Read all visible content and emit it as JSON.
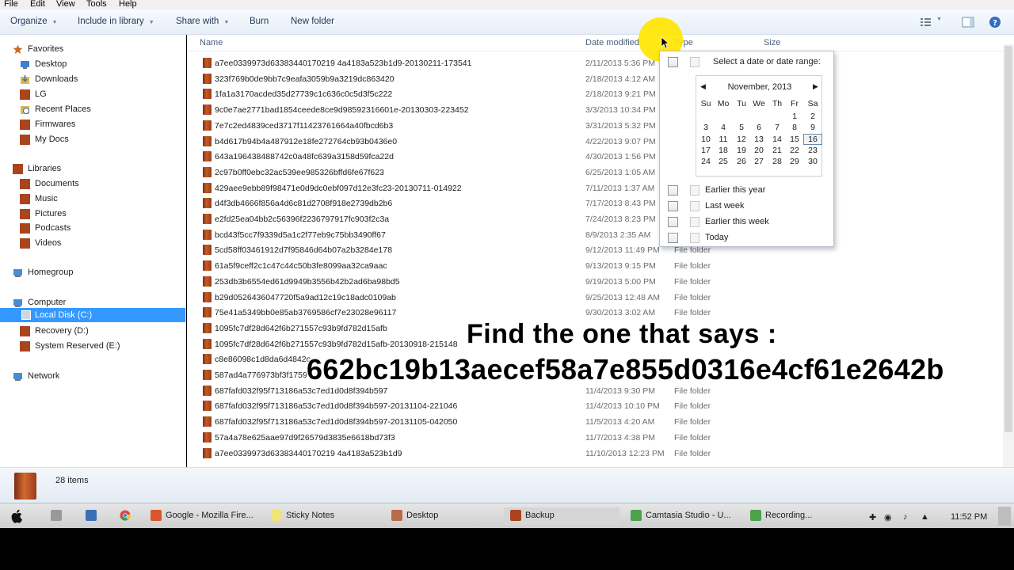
{
  "menu": [
    "File",
    "Edit",
    "View",
    "Tools",
    "Help"
  ],
  "toolbar": {
    "organize": "Organize",
    "include": "Include in library",
    "share": "Share with",
    "burn": "Burn",
    "new_folder": "New folder"
  },
  "nav": {
    "favorites": "Favorites",
    "desktop": "Desktop",
    "downloads": "Downloads",
    "lg": "LG",
    "recent": "Recent Places",
    "firmwares": "Firmwares",
    "mydocs": "My Docs",
    "libraries": "Libraries",
    "documents": "Documents",
    "music": "Music",
    "pictures": "Pictures",
    "podcasts": "Podcasts",
    "videos": "Videos",
    "homegroup": "Homegroup",
    "computer": "Computer",
    "local_disk": "Local Disk (C:)",
    "recovery": "Recovery (D:)",
    "system_reserved": "System Reserved (E:)",
    "network": "Network"
  },
  "columns": {
    "name": "Name",
    "date": "Date modified",
    "type": "Type",
    "size": "Size"
  },
  "files": [
    {
      "name": "a7ee0339973d63383440170219 4a4183a523b1d9-20130211-173541",
      "date": "2/11/2013 5:36 PM",
      "type": ""
    },
    {
      "name": "323f769b0de9bb7c9eafa3059b9a3219dc863420",
      "date": "2/18/2013 4:12 AM",
      "type": ""
    },
    {
      "name": "1fa1a3170acded35d27739c1c636c0c5d3f5c222",
      "date": "2/18/2013 9:21 PM",
      "type": ""
    },
    {
      "name": "9c0e7ae2771bad1854ceede8ce9d98592316601e-20130303-223452",
      "date": "3/3/2013 10:34 PM",
      "type": ""
    },
    {
      "name": "7e7c2ed4839ced3717f11423761664a40fbcd6b3",
      "date": "3/31/2013 5:32 PM",
      "type": ""
    },
    {
      "name": "b4d617b94b4a487912e18fe272764cb93b0436e0",
      "date": "4/22/2013 9:07 PM",
      "type": ""
    },
    {
      "name": "643a196438488742c0a48fc639a3158d59fca22d",
      "date": "4/30/2013 1:56 PM",
      "type": ""
    },
    {
      "name": "2c97b0ff0ebc32ac539ee985326bffd6fe67f623",
      "date": "6/25/2013 1:05 AM",
      "type": ""
    },
    {
      "name": "429aee9ebb89f98471e0d9dc0ebf097d12e3fc23-20130711-014922",
      "date": "7/11/2013 1:37 AM",
      "type": ""
    },
    {
      "name": "d4f3db4666f856a4d6c81d2708f918e2739db2b6",
      "date": "7/17/2013 8:43 PM",
      "type": ""
    },
    {
      "name": "e2fd25ea04bb2c56396f2236797917fc903f2c3a",
      "date": "7/24/2013 8:23 PM",
      "type": ""
    },
    {
      "name": "bcd43f5cc7f9339d5a1c2f77eb9c75bb3490ff67",
      "date": "8/9/2013 2:35 AM",
      "type": ""
    },
    {
      "name": "5cd58ff03461912d7f95846d64b07a2b3284e178",
      "date": "9/12/2013 11:49 PM",
      "type": "File folder"
    },
    {
      "name": "61a5f9ceff2c1c47c44c50b3fe8099aa32ca9aac",
      "date": "9/13/2013 9:15 PM",
      "type": "File folder"
    },
    {
      "name": "253db3b6554ed61d9949b3556b42b2ad6ba98bd5",
      "date": "9/19/2013 5:00 PM",
      "type": "File folder"
    },
    {
      "name": "b29d0526436047720f5a9ad12c19c18adc0109ab",
      "date": "9/25/2013 12:48 AM",
      "type": "File folder"
    },
    {
      "name": "75e41a5349bb0e85ab3769586cf7e23028e96117",
      "date": "9/30/2013 3:02 AM",
      "type": "File folder"
    },
    {
      "name": "1095fc7df28d642f6b271557c93b9fd782d15afb",
      "date": "",
      "type": ""
    },
    {
      "name": "1095fc7df28d642f6b271557c93b9fd782d15afb-20130918-215148",
      "date": "",
      "type": ""
    },
    {
      "name": "c8e86098c1d8da6d4842c",
      "date": "",
      "type": ""
    },
    {
      "name": "587ad4a776973bf3f1759",
      "date": "",
      "type": ""
    },
    {
      "name": "687fafd032f95f713186a53c7ed1d0d8f394b597",
      "date": "11/4/2013 9:30 PM",
      "type": "File folder"
    },
    {
      "name": "687fafd032f95f713186a53c7ed1d0d8f394b597-20131104-221046",
      "date": "11/4/2013 10:10 PM",
      "type": "File folder"
    },
    {
      "name": "687fafd032f95f713186a53c7ed1d0d8f394b597-20131105-042050",
      "date": "11/5/2013 4:20 AM",
      "type": "File folder"
    },
    {
      "name": "57a4a78e625aae97d9f26579d3835e6618bd73f3",
      "date": "11/7/2013 4:38 PM",
      "type": "File folder"
    },
    {
      "name": "a7ee0339973d63383440170219 4a4183a523b1d9",
      "date": "11/10/2013 12:23 PM",
      "type": "File folder"
    }
  ],
  "overlay": {
    "line1": "Find the one that says :",
    "line2": "662bc19b13aecef58a7e855d0316e4cf61e2642b"
  },
  "popup": {
    "range_label": "Select a date or date range:",
    "month": "November, 2013",
    "weekdays": [
      "Su",
      "Mo",
      "Tu",
      "We",
      "Th",
      "Fr",
      "Sa"
    ],
    "weeks": [
      [
        "",
        "",
        "",
        "",
        "",
        "1",
        "2"
      ],
      [
        "3",
        "4",
        "5",
        "6",
        "7",
        "8",
        "9"
      ],
      [
        "10",
        "11",
        "12",
        "13",
        "14",
        "15",
        "16"
      ],
      [
        "17",
        "18",
        "19",
        "20",
        "21",
        "22",
        "23"
      ],
      [
        "24",
        "25",
        "26",
        "27",
        "28",
        "29",
        "30"
      ]
    ],
    "today_day": "16",
    "options": [
      "Earlier this year",
      "Last week",
      "Earlier this week",
      "Today"
    ]
  },
  "status": {
    "count": "28 items"
  },
  "taskbar": {
    "firefox": "Google - Mozilla Fire...",
    "sticky": "Sticky Notes",
    "desktop": "Desktop",
    "backup": "Backup",
    "camtasia": "Camtasia Studio - U...",
    "recording": "Recording...",
    "time": "11:52 PM"
  }
}
